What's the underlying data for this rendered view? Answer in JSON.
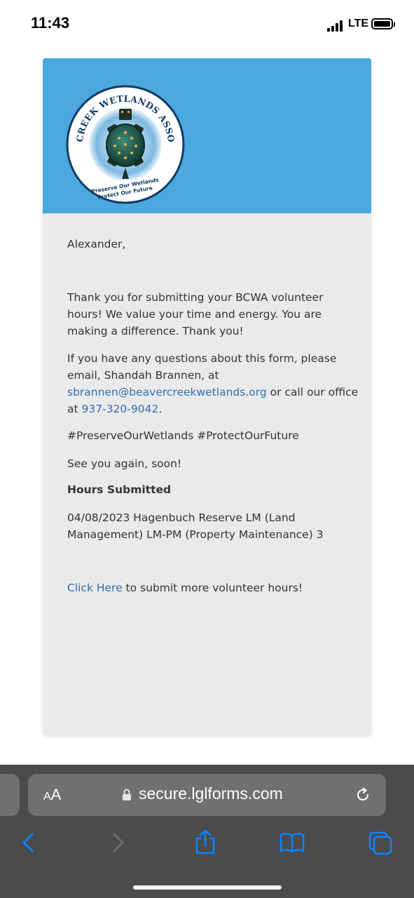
{
  "status_bar": {
    "time": "11:43",
    "network": "LTE"
  },
  "email": {
    "logo": {
      "arc_top": "BEAVER CREEK WETLANDS ASSOCIATION",
      "tagline_1": "Preserve Our Wetlands",
      "tagline_2": "Protect Our Future"
    },
    "greeting": "Alexander,",
    "paragraph_1": "Thank you for submitting your BCWA volunteer hours! We value your time and energy. You are making a difference. Thank you!",
    "paragraph_2_prefix": "If you have any questions about this form, please email, Shandah Brannen, at ",
    "contact_email": "sbrannen@beavercreekwetlands.org",
    "paragraph_2_middle": " or call our office at ",
    "contact_phone": "937-320-9042",
    "paragraph_2_suffix": ".",
    "hashtags": "#PreserveOurWetlands #ProtectOurFuture",
    "signoff": "See you again, soon!",
    "hours_heading": "Hours Submitted",
    "hours_entry": "04/08/2023 Hagenbuch Reserve LM (Land Management) LM-PM (Property Maintenance) 3",
    "cta_link": "Click Here",
    "cta_text": " to submit more volunteer hours!"
  },
  "browser": {
    "text_size_label_small": "A",
    "text_size_label_large": "A",
    "url": "secure.lglforms.com",
    "icons": [
      "lock-icon",
      "reload-icon",
      "back-icon",
      "forward-icon",
      "share-icon",
      "bookmarks-icon",
      "tabs-icon"
    ],
    "accent_color": "#0a84ff"
  },
  "colors": {
    "banner": "#4aa8dc",
    "card_background": "#ebeaea",
    "link": "#2e6fae"
  }
}
